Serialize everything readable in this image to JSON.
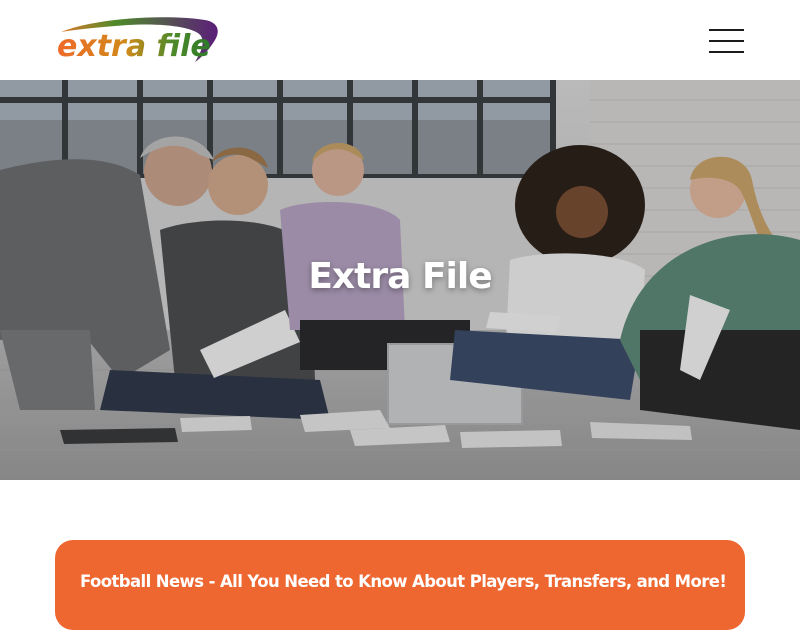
{
  "header": {
    "logo_text": "extra file",
    "menu_icon": "hamburger-menu-icon"
  },
  "hero": {
    "title": "Extra File"
  },
  "news": {
    "title": "Football News - All You Need to Know About Players, Transfers, and More!"
  },
  "colors": {
    "accent": "#ee6630",
    "logo_swoosh": "#5b1e7a",
    "logo_text_start": "#ef6a2a",
    "logo_text_end": "#2c7a2a",
    "menu": "#1b1b1b"
  }
}
